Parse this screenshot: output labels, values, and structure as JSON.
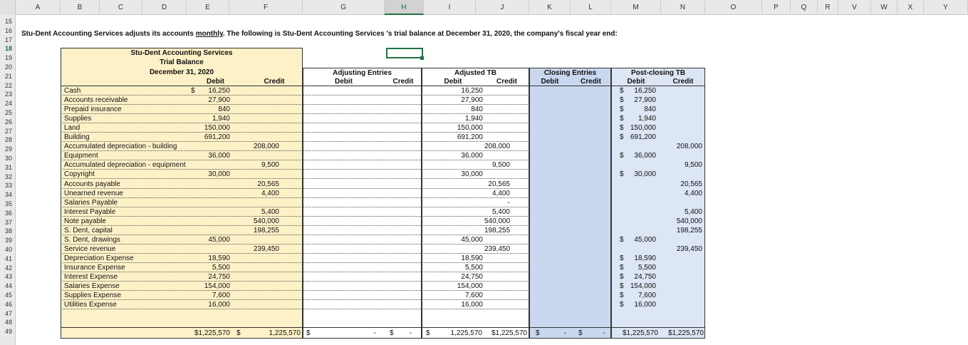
{
  "columns": [
    "A",
    "B",
    "C",
    "D",
    "E",
    "F",
    "G",
    "H",
    "I",
    "J",
    "K",
    "L",
    "M",
    "N",
    "O",
    "P",
    "Q",
    "R",
    "V",
    "W",
    "X",
    "Y"
  ],
  "selected_column": "H",
  "rows": [
    "15",
    "16",
    "17",
    "18",
    "19",
    "20",
    "21",
    "22",
    "23",
    "24",
    "25",
    "26",
    "27",
    "28",
    "29",
    "30",
    "31",
    "32",
    "33",
    "34",
    "35",
    "36",
    "37",
    "38",
    "39",
    "40",
    "41",
    "42",
    "43",
    "44",
    "45",
    "46",
    "47",
    "48",
    "49"
  ],
  "selected_row": "18",
  "intro": {
    "text_before": "Stu-Dent Accounting Services adjusts its accounts ",
    "text_underlined": "monthly",
    "text_after": ". The following is Stu-Dent Accounting Services 's trial balance at December 31, 2020, the company's fiscal year end:"
  },
  "tb_header": {
    "company": "Stu-Dent Accounting Services",
    "title": "Trial Balance",
    "date": "December 31, 2020"
  },
  "col_headers": {
    "debit": "Debit",
    "credit": "Credit",
    "adjusting": "Adjusting Entries",
    "adjusted": "Adjusted TB",
    "closing": "Closing Entries",
    "postclosing": "Post-closing TB"
  },
  "accounts": [
    {
      "name": "Cash",
      "tb_dr": "16,250",
      "tb_cr": "",
      "adj_dr": "16,250",
      "adj_cr": "",
      "pc_dr": "16,250",
      "pc_cr": "",
      "tb_dollar": true,
      "pc_dollar": true
    },
    {
      "name": "Accounts receivable",
      "tb_dr": "27,900",
      "tb_cr": "",
      "adj_dr": "27,900",
      "adj_cr": "",
      "pc_dr": "27,900",
      "pc_cr": "",
      "pc_dollar": true
    },
    {
      "name": "Prepaid insurance",
      "tb_dr": "840",
      "tb_cr": "",
      "adj_dr": "840",
      "adj_cr": "",
      "pc_dr": "840",
      "pc_cr": "",
      "pc_dollar": true
    },
    {
      "name": "Supplies",
      "tb_dr": "1,940",
      "tb_cr": "",
      "adj_dr": "1,940",
      "adj_cr": "",
      "pc_dr": "1,940",
      "pc_cr": "",
      "pc_dollar": true
    },
    {
      "name": "Land",
      "tb_dr": "150,000",
      "tb_cr": "",
      "adj_dr": "150,000",
      "adj_cr": "",
      "pc_dr": "150,000",
      "pc_cr": "",
      "pc_dollar": true
    },
    {
      "name": "Building",
      "tb_dr": "691,200",
      "tb_cr": "",
      "adj_dr": "691,200",
      "adj_cr": "",
      "pc_dr": "691,200",
      "pc_cr": "",
      "pc_dollar": true
    },
    {
      "name": "Accumulated depreciation - building",
      "tb_dr": "",
      "tb_cr": "208,000",
      "adj_dr": "",
      "adj_cr": "208,000",
      "pc_dr": "",
      "pc_cr": "208,000"
    },
    {
      "name": "Equipment",
      "tb_dr": "36,000",
      "tb_cr": "",
      "adj_dr": "36,000",
      "adj_cr": "",
      "pc_dr": "36,000",
      "pc_cr": "",
      "pc_dollar": true
    },
    {
      "name": "Accumulated depreciation - equipment",
      "tb_dr": "",
      "tb_cr": "9,500",
      "adj_dr": "",
      "adj_cr": "9,500",
      "pc_dr": "",
      "pc_cr": "9,500"
    },
    {
      "name": "Copyright",
      "tb_dr": "30,000",
      "tb_cr": "",
      "adj_dr": "30,000",
      "adj_cr": "",
      "pc_dr": "30,000",
      "pc_cr": "",
      "pc_dollar": true
    },
    {
      "name": "Accounts payable",
      "tb_dr": "",
      "tb_cr": "20,565",
      "adj_dr": "",
      "adj_cr": "20,565",
      "pc_dr": "",
      "pc_cr": "20,565"
    },
    {
      "name": "Unearned revenue",
      "tb_dr": "",
      "tb_cr": "4,400",
      "adj_dr": "",
      "adj_cr": "4,400",
      "pc_dr": "",
      "pc_cr": "4,400"
    },
    {
      "name": "Salaries Payable",
      "tb_dr": "",
      "tb_cr": "",
      "adj_dr": "",
      "adj_cr": "-",
      "pc_dr": "",
      "pc_cr": ""
    },
    {
      "name": "Interest Payable",
      "tb_dr": "",
      "tb_cr": "5,400",
      "adj_dr": "",
      "adj_cr": "5,400",
      "pc_dr": "",
      "pc_cr": "5,400"
    },
    {
      "name": "Note payable",
      "tb_dr": "",
      "tb_cr": "540,000",
      "adj_dr": "",
      "adj_cr": "540,000",
      "pc_dr": "",
      "pc_cr": "540,000"
    },
    {
      "name": "S. Dent, capital",
      "tb_dr": "",
      "tb_cr": "198,255",
      "adj_dr": "",
      "adj_cr": "198,255",
      "pc_dr": "",
      "pc_cr": "198,255"
    },
    {
      "name": "S. Dent, drawings",
      "tb_dr": "45,000",
      "tb_cr": "",
      "adj_dr": "45,000",
      "adj_cr": "",
      "pc_dr": "45,000",
      "pc_cr": "",
      "pc_dollar": true
    },
    {
      "name": "Service revenue",
      "tb_dr": "",
      "tb_cr": "239,450",
      "adj_dr": "",
      "adj_cr": "239,450",
      "pc_dr": "",
      "pc_cr": "239,450"
    },
    {
      "name": "Depreciation Expense",
      "tb_dr": "18,590",
      "tb_cr": "",
      "adj_dr": "18,590",
      "adj_cr": "",
      "pc_dr": "18,590",
      "pc_cr": "",
      "pc_dollar": true
    },
    {
      "name": "Insurance Expense",
      "tb_dr": "5,500",
      "tb_cr": "",
      "adj_dr": "5,500",
      "adj_cr": "",
      "pc_dr": "5,500",
      "pc_cr": "",
      "pc_dollar": true
    },
    {
      "name": "Interest Expense",
      "tb_dr": "24,750",
      "tb_cr": "",
      "adj_dr": "24,750",
      "adj_cr": "",
      "pc_dr": "24,750",
      "pc_cr": "",
      "pc_dollar": true
    },
    {
      "name": "Salaries Expense",
      "tb_dr": "154,000",
      "tb_cr": "",
      "adj_dr": "154,000",
      "adj_cr": "",
      "pc_dr": "154,000",
      "pc_cr": "",
      "pc_dollar": true
    },
    {
      "name": "Supplies Expense",
      "tb_dr": "7,600",
      "tb_cr": "",
      "adj_dr": "7,600",
      "adj_cr": "",
      "pc_dr": "7,600",
      "pc_cr": "",
      "pc_dollar": true
    },
    {
      "name": "Utilities Expense",
      "tb_dr": "16,000",
      "tb_cr": "",
      "adj_dr": "16,000",
      "adj_cr": "",
      "pc_dr": "16,000",
      "pc_cr": "",
      "pc_dollar": true
    }
  ],
  "totals": {
    "tb_dr": "$1,225,570",
    "tb_cr_sign": "$",
    "tb_cr": "1,225,570",
    "ae_dr_sign": "$",
    "ae_dr": "-",
    "ae_cr_sign": "$",
    "ae_cr": "-",
    "adj_dr_sign": "$",
    "adj_dr": "1,225,570",
    "adj_cr": "$1,225,570",
    "ce_dr_sign": "$",
    "ce_dr": "-",
    "ce_cr_sign": "$",
    "ce_cr": "-",
    "pc_dr": "$1,225,570",
    "pc_cr": "$1,225,570"
  },
  "dollar_sign": "$",
  "colors": {
    "tb_fill": "#fdf1c7",
    "closing_fill": "#c9d8ef",
    "postclosing_fill": "#dce6f4",
    "header_bg": "#e9e9e9",
    "select_green": "#217346"
  }
}
